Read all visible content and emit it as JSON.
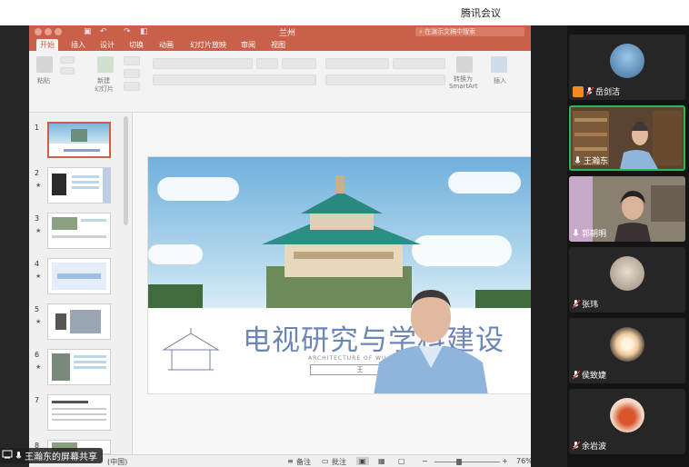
{
  "app": {
    "title": "腾讯会议"
  },
  "ppt": {
    "doc_title": "兰州",
    "search_placeholder": "在演示文稿中搜索",
    "tabs": [
      "开始",
      "插入",
      "设计",
      "切换",
      "动画",
      "幻灯片放映",
      "审阅",
      "视图"
    ],
    "ribbon": {
      "paste": "粘贴",
      "new_slide_1": "新建",
      "new_slide_2": "幻灯片",
      "smartart_1": "转换为",
      "smartart_2": "SmartArt",
      "insert": "插入"
    },
    "thumbnails": [
      {
        "num": "1",
        "star": ""
      },
      {
        "num": "2",
        "star": "★"
      },
      {
        "num": "3",
        "star": "★"
      },
      {
        "num": "4",
        "star": "★"
      },
      {
        "num": "5",
        "star": "★"
      },
      {
        "num": "6",
        "star": "★"
      },
      {
        "num": "7",
        "star": ""
      },
      {
        "num": "8",
        "star": "★"
      }
    ],
    "slide": {
      "title": "电视研究与学科建设",
      "subtitle": "ARCHITECTURE OF WU",
      "box_text": "王"
    },
    "status": {
      "language": "(中国)",
      "notes": "备注",
      "comments": "批注",
      "zoom": "76%",
      "zoom_fraction": 0.45
    }
  },
  "sharer": {
    "label": "王瀚东的屏幕共享"
  },
  "participants": [
    {
      "name": "岳剑洁",
      "host": true,
      "muted": true,
      "type": "avatar",
      "avatar_color": "#4e86b8"
    },
    {
      "name": "王瀚东",
      "host": false,
      "muted": false,
      "type": "video",
      "active": true
    },
    {
      "name": "郭朝明",
      "host": false,
      "muted": false,
      "type": "video"
    },
    {
      "name": "张玮",
      "host": false,
      "muted": true,
      "type": "avatar",
      "avatar_color": "#c6b8a8"
    },
    {
      "name": "侯致婕",
      "host": false,
      "muted": true,
      "type": "avatar",
      "avatar_color": "#e9c7a2"
    },
    {
      "name": "余岩波",
      "host": false,
      "muted": true,
      "type": "avatar",
      "avatar_color": "#c54a2c"
    }
  ],
  "colors": {
    "ppt_accent": "#c9604a",
    "speaker_border": "#2fb65a",
    "slide_title": "#6d86b6"
  }
}
